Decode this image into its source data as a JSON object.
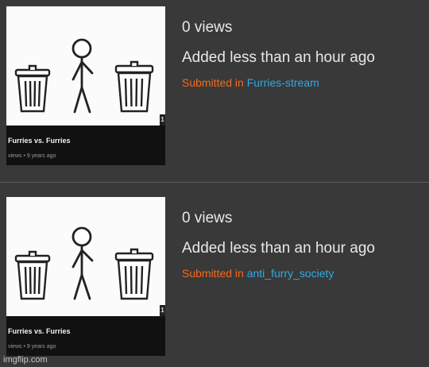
{
  "entries": [
    {
      "views": "0 views",
      "added": "Added less than an hour ago",
      "submitted_prefix": "Submitted in",
      "stream": "Furries-stream",
      "video": {
        "title": "Furries vs. Furries",
        "meta": "views • 9 years ago",
        "badge": "1"
      }
    },
    {
      "views": "0 views",
      "added": "Added less than an hour ago",
      "submitted_prefix": "Submitted in",
      "stream": "anti_furry_society",
      "video": {
        "title": "Furries vs. Furries",
        "meta": "views • 9 years ago",
        "badge": "1"
      }
    }
  ],
  "watermark": "imgflip.com",
  "colors": {
    "background": "#393939",
    "submitted_prefix": "#f26b1d",
    "stream_link": "#2eaae6"
  },
  "icons": [
    "trash-can-icon",
    "stick-figure-icon"
  ]
}
